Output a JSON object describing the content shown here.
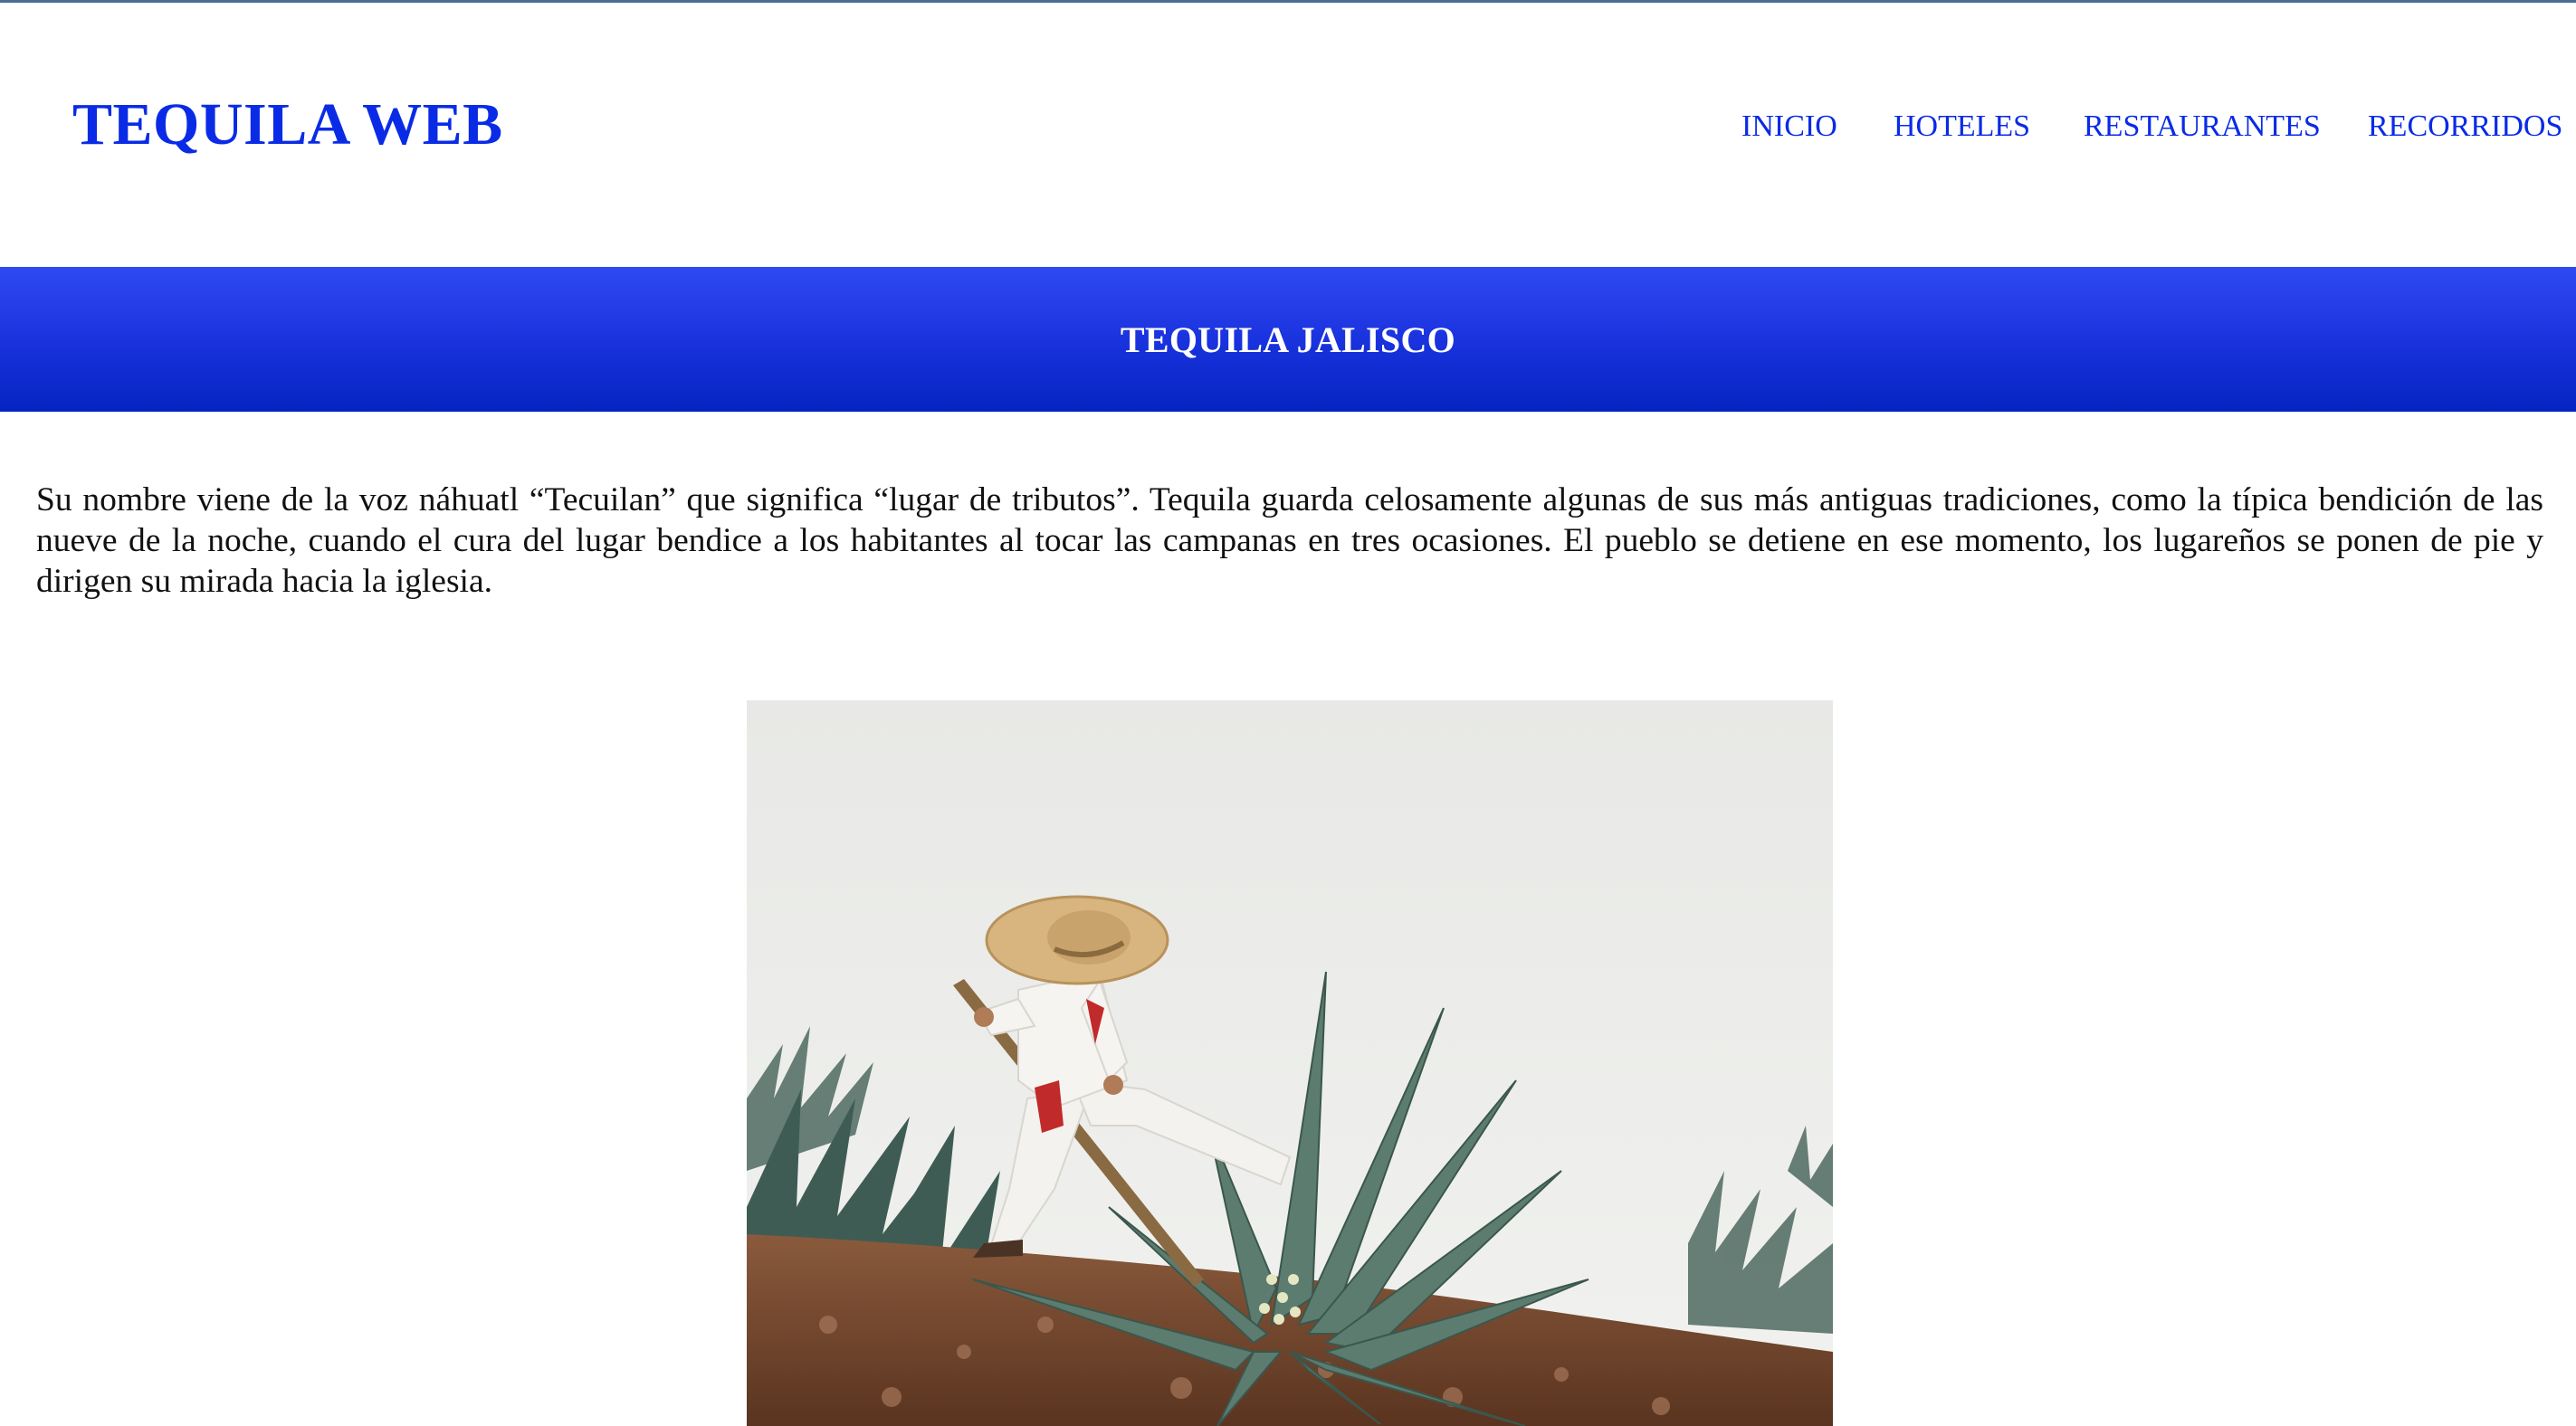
{
  "header": {
    "logo": "TEQUILA WEB",
    "nav": [
      "INICIO",
      "HOTELES",
      "RESTAURANTES",
      "RECORRIDOS"
    ]
  },
  "banner": {
    "title": "TEQUILA JALISCO"
  },
  "content": {
    "intro": "Su nombre viene de la voz náhuatl “Tecuilan” que significa “lugar de tributos”. Tequila guarda celosamente algunas de sus más antiguas tradiciones, como la típica bendición de las nueve de la noche, cuando el cura del lugar bendice a los habitantes al tocar las campanas en tres ocasiones. El pueblo se detiene en ese momento, los lugareños se ponen de pie y dirigen su mirada hacia la iglesia."
  },
  "colors": {
    "link": "#0a2be6",
    "banner_top": "#2f49f2",
    "banner_bottom": "#0524c0"
  },
  "image": {
    "subject": "jimador-harvesting-blue-agave-photo"
  }
}
